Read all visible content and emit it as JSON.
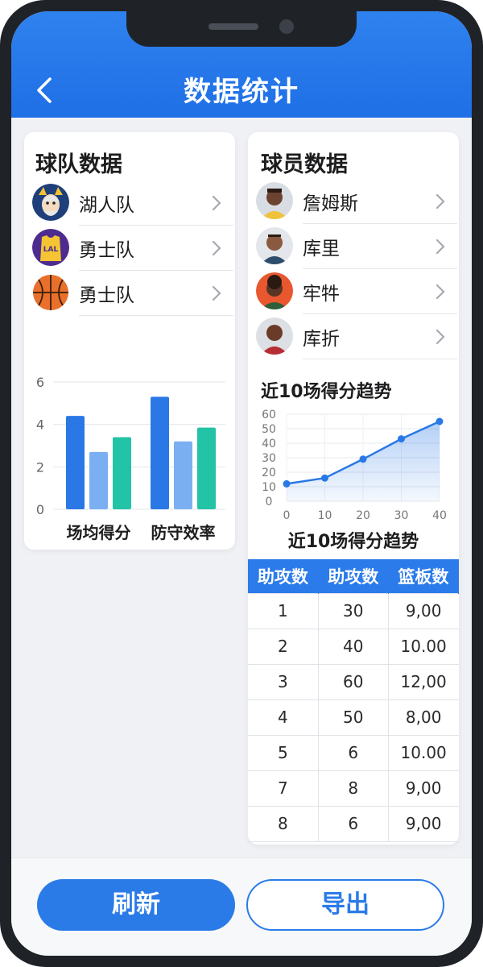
{
  "header": {
    "title": "数据统计"
  },
  "team_panel": {
    "title": "球队数据",
    "items": [
      {
        "label": "湖人队",
        "icon": "lakers-mascot-avatar"
      },
      {
        "label": "勇士队",
        "icon": "lakers-jersey-avatar"
      },
      {
        "label": "勇士队",
        "icon": "basketball-avatar"
      }
    ]
  },
  "team_chart": {
    "type": "bar",
    "categories": [
      "场均得分",
      "防守效率"
    ],
    "series": [
      {
        "values": [
          4.4,
          5.3
        ],
        "color": "#2a78e6"
      },
      {
        "values": [
          2.7,
          3.2
        ],
        "color": "#7ab0f2"
      },
      {
        "values": [
          3.4,
          3.85
        ],
        "color": "#22c3a6"
      }
    ],
    "yticks": [
      "0",
      "2",
      "4",
      "6"
    ],
    "ylim": [
      0,
      6
    ]
  },
  "player_panel": {
    "title": "球员数据",
    "items": [
      {
        "label": "詹姆斯",
        "icon": "player-avatar"
      },
      {
        "label": "库里",
        "icon": "player-avatar"
      },
      {
        "label": "牢牪",
        "icon": "player-avatar"
      },
      {
        "label": "库折",
        "icon": "player-avatar"
      }
    ]
  },
  "chart_data": {
    "type": "line",
    "title": "近10场得分趋势",
    "caption": "近10场得分趋势",
    "x": [
      0,
      10,
      20,
      30,
      40
    ],
    "y": [
      12,
      16,
      29,
      43,
      55
    ],
    "xticks": [
      "0",
      "10",
      "20",
      "30",
      "40"
    ],
    "yticks": [
      "0",
      "10",
      "20",
      "30",
      "40",
      "50",
      "60"
    ],
    "xlim": [
      0,
      40
    ],
    "ylim": [
      0,
      60
    ],
    "grid": true,
    "color": "#2a78e6"
  },
  "stats_table": {
    "headers": [
      "助攻数",
      "助攻数",
      "篮板数"
    ],
    "rows": [
      [
        "1",
        "30",
        "9,00"
      ],
      [
        "2",
        "40",
        "10.00"
      ],
      [
        "3",
        "60",
        "12,00"
      ],
      [
        "4",
        "50",
        "8,00"
      ],
      [
        "5",
        "6",
        "10.00"
      ],
      [
        "7",
        "8",
        "9,00"
      ],
      [
        "8",
        "6",
        "9,00"
      ]
    ]
  },
  "footer": {
    "refresh_label": "刷新",
    "export_label": "导出"
  },
  "colors": {
    "primary": "#2a7be8",
    "teal": "#22c3a6",
    "light_blue": "#7ab0f2"
  }
}
